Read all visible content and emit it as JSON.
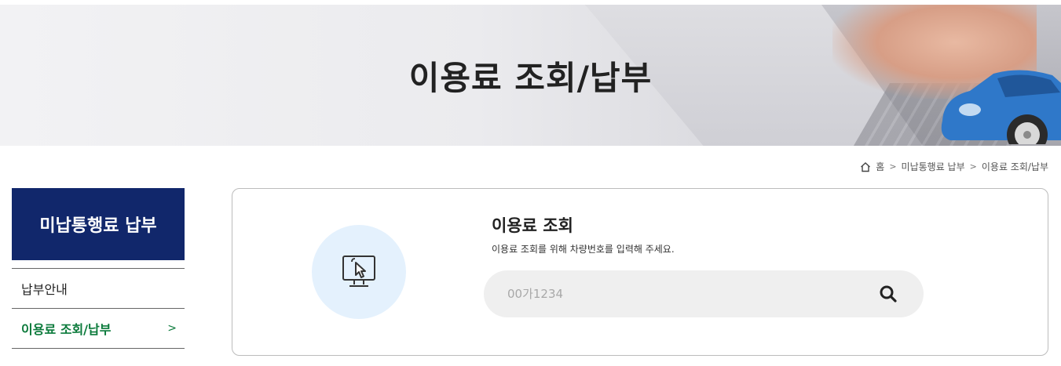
{
  "hero": {
    "title": "이용료 조회/납부"
  },
  "breadcrumb": {
    "icon": "home-icon",
    "items": [
      "홈",
      "미납통행료 납부",
      "이용료 조회/납부"
    ],
    "separator": ">"
  },
  "sidebar": {
    "title": "미납통행료 납부",
    "items": [
      {
        "label": "납부안내",
        "active": false
      },
      {
        "label": "이용료 조회/납부",
        "active": true,
        "chevron": ">"
      }
    ],
    "active_color": "#0b7a3b",
    "title_bg": "#11276b"
  },
  "lookup": {
    "icon": "touch-screen-icon",
    "title": "이용료 조회",
    "description": "이용료 조회를 위해 차량번호를 입력해 주세요.",
    "search": {
      "placeholder": "00가1234",
      "value": "",
      "button_icon": "search-icon"
    }
  }
}
